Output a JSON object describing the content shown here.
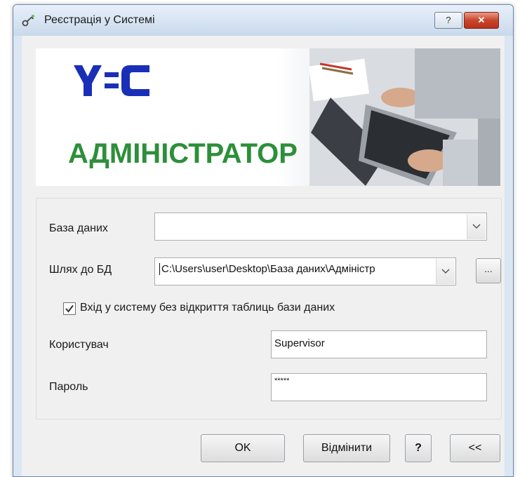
{
  "window": {
    "title": "Реєстрація у Системі",
    "help_label": "?",
    "close_label": "✕"
  },
  "banner": {
    "logo_text": "У-С",
    "heading": "АДМІНІСТРАТОР"
  },
  "form": {
    "database": {
      "label": "База даних",
      "value": ""
    },
    "db_path": {
      "label": "Шлях до БД",
      "value": "C:\\Users\\user\\Desktop\\База даних\\Адміністр",
      "browse_label": "..."
    },
    "no_tables_checkbox": {
      "label": "Вхід у систему без відкриття таблиць бази даних",
      "checked": true
    },
    "user": {
      "label": "Користувач",
      "value": "Supervisor"
    },
    "password": {
      "label": "Пароль",
      "value": "*****"
    }
  },
  "buttons": {
    "ok": "OK",
    "cancel": "Відмінити",
    "help": "?",
    "collapse": "<<"
  },
  "colors": {
    "accent_green": "#2d8f3a",
    "logo_blue": "#1a2fb8",
    "close_red": "#c9452c"
  },
  "icons": {
    "title": "keys-icon",
    "combo": "chevron-down-icon",
    "check": "checkmark-icon"
  }
}
